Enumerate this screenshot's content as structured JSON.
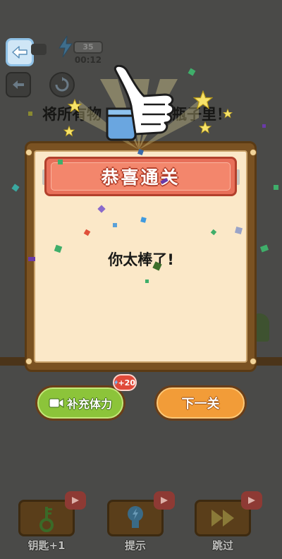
{
  "hud": {
    "energy_value": "35",
    "timer": "00:12"
  },
  "level": {
    "instruction_left": "将所有物",
    "instruction_right": "瓶子里！"
  },
  "result_dialog": {
    "title": "恭喜通关",
    "message": "你太棒了!"
  },
  "actions": {
    "refill_label": "补充体力",
    "refill_bonus": "+20",
    "next_label": "下一关"
  },
  "tools": [
    {
      "label": "钥匙+1",
      "icon": "key-icon"
    },
    {
      "label": "提示",
      "icon": "lightbulb-icon"
    },
    {
      "label": "跳过",
      "icon": "skip-icon"
    }
  ],
  "colors": {
    "background": "#4a4a48",
    "panel_frame": "#7a5222",
    "panel_fill": "#fbe8c8",
    "banner": "#f3866c",
    "refill_button": "#8cc43a",
    "next_button": "#f29c38",
    "badge": "#e04a3a"
  }
}
